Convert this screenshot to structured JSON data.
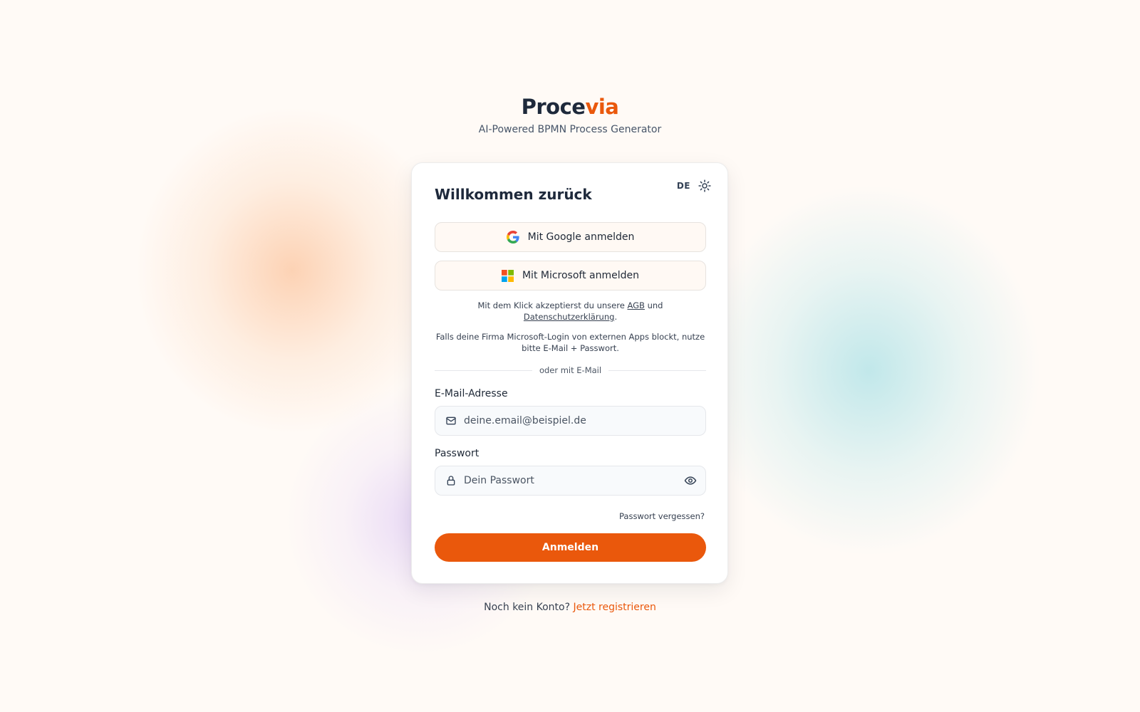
{
  "brand": {
    "name_main": "Proce",
    "name_accent": "via",
    "tagline": "AI-Powered BPMN Process Generator"
  },
  "card": {
    "title": "Willkommen zurück",
    "language": "DE",
    "theme_icon": "sun-icon"
  },
  "oauth": {
    "google_label": "Mit Google anmelden",
    "microsoft_label": "Mit Microsoft anmelden"
  },
  "legal": {
    "prefix": "Mit dem Klick akzeptierst du unsere ",
    "terms_link": "AGB",
    "middle": " und",
    "privacy_link": "Datenschutzerklärung",
    "suffix": "."
  },
  "hint": "Falls deine Firma Microsoft-Login von externen Apps blockt, nutze bitte E-Mail + Passwort.",
  "divider_text": "oder mit E-Mail",
  "email": {
    "label": "E-Mail-Adresse",
    "placeholder": "deine.email@beispiel.de",
    "value": ""
  },
  "password": {
    "label": "Passwort",
    "placeholder": "Dein Passwort",
    "value": ""
  },
  "forgot_label": "Passwort vergessen?",
  "submit_label": "Anmelden",
  "signup": {
    "prompt": "Noch kein Konto? ",
    "link": "Jetzt registrieren"
  },
  "colors": {
    "accent": "#ea580c",
    "text": "#1e293b",
    "background": "#fffaf6"
  }
}
